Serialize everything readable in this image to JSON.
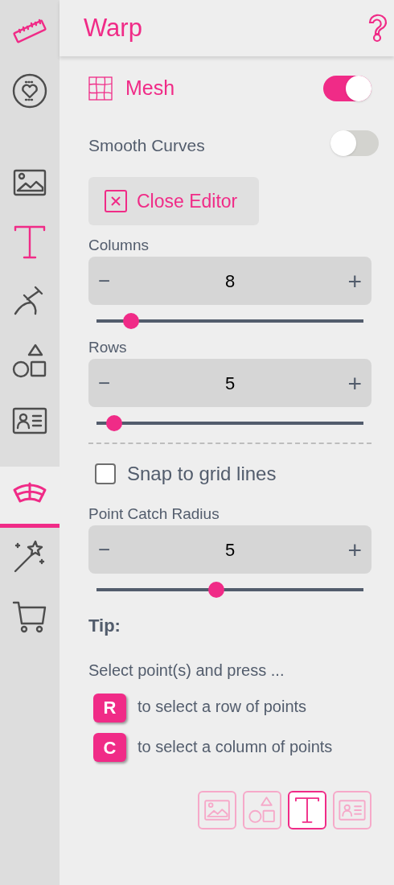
{
  "sidebar": {
    "items": [
      {
        "kind": "ruler",
        "accent": true,
        "selected": false
      },
      {
        "kind": "heart-badge",
        "accent": false,
        "selected": false
      },
      {
        "kind": "image",
        "accent": false,
        "selected": false
      },
      {
        "kind": "text",
        "accent": true,
        "selected": false
      },
      {
        "kind": "curve",
        "accent": false,
        "selected": false
      },
      {
        "kind": "shapes",
        "accent": false,
        "selected": false
      },
      {
        "kind": "id-card",
        "accent": false,
        "selected": false
      },
      {
        "kind": "warp",
        "accent": true,
        "selected": true
      },
      {
        "kind": "wand",
        "accent": false,
        "selected": false
      },
      {
        "kind": "cart",
        "accent": false,
        "selected": false
      }
    ]
  },
  "header": {
    "title": "Warp"
  },
  "mesh": {
    "label": "Mesh",
    "on": true
  },
  "smooth_curves": {
    "label": "Smooth Curves",
    "on": false
  },
  "close_button": "Close Editor",
  "steppers": [
    {
      "label": "Columns",
      "minus": "−",
      "value": "8",
      "plus": "+",
      "level": 0.105
    },
    {
      "label": "Rows",
      "minus": "−",
      "value": "5",
      "plus": "+",
      "level": 0.04
    }
  ],
  "snap": {
    "label": "Snap to grid lines",
    "checked": false
  },
  "radius": {
    "label": "Point Catch Radius",
    "minus": "−",
    "value": "5",
    "plus": "+",
    "level": 0.446
  },
  "tip": {
    "title": "Tip:",
    "intro": "Select point(s) and press ...",
    "keys": [
      {
        "key": "R",
        "text": "to select a row of points"
      },
      {
        "key": "C",
        "text": "to select a column of points"
      }
    ]
  },
  "layer_types": [
    {
      "kind": "image",
      "selected": false
    },
    {
      "kind": "shapes",
      "selected": false
    },
    {
      "kind": "text",
      "selected": true
    },
    {
      "kind": "id-card",
      "selected": false
    }
  ]
}
